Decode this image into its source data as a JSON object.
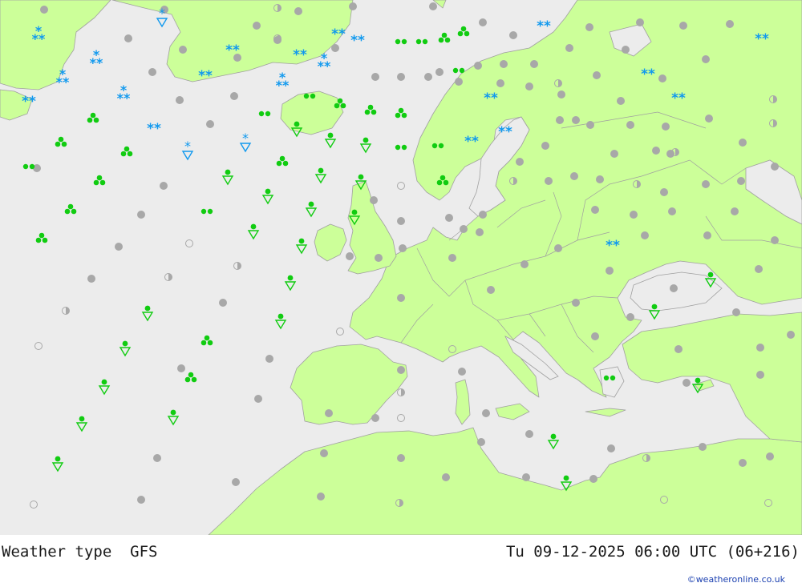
{
  "title": "Weather type",
  "model": "GFS",
  "valid_time": "Tu 09-12-2025 06:00 UTC (06+216)",
  "credit": "©weatheronline.co.uk",
  "colors": {
    "sea": "#ececec",
    "land": "#ccff99",
    "border": "#a0a0a0",
    "rain": "#11cc11",
    "snow": "#1199ee",
    "cloud": "#a8a8a8"
  },
  "legend_symbols": [
    "overcast-dot",
    "partly-cloudy-half-circle",
    "clear-open-circle",
    "drizzle-two-dots",
    "rain-showers-triangle",
    "heavy-rain-clubs",
    "snow-asterisks"
  ]
}
